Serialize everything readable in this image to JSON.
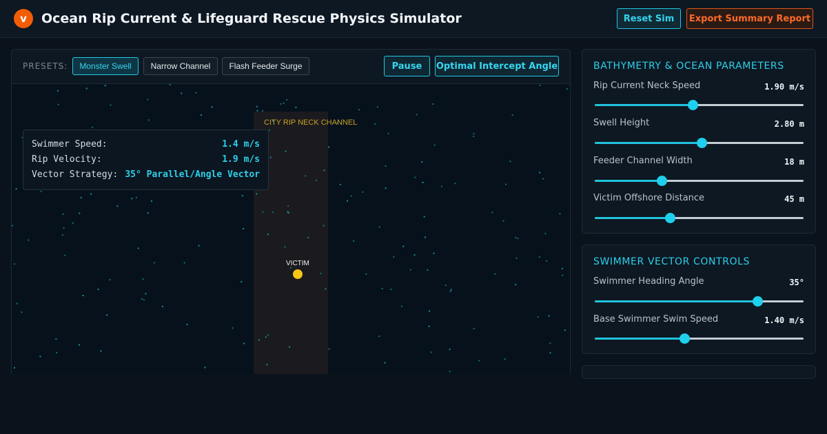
{
  "header": {
    "logo_letter": "v",
    "title": "Ocean Rip Current & Lifeguard Rescue Physics Simulator",
    "reset_label": "Reset Sim",
    "export_label": "Export Summary Report"
  },
  "toolbar": {
    "presets_label": "PRESETS:",
    "presets": [
      "Monster Swell",
      "Narrow Channel",
      "Flash Feeder Surge"
    ],
    "active_preset": "Monster Swell",
    "pause_label": "Pause",
    "intercept_label": "Optimal Intercept Angle"
  },
  "stats": [
    {
      "label": "Swimmer Speed:",
      "value": "1.4 m/s"
    },
    {
      "label": "Rip Velocity:",
      "value": "1.9 m/s"
    },
    {
      "label": "Vector Strategy:",
      "value": "35° Parallel/Angle Vector"
    }
  ],
  "canvas": {
    "channel_label": "CITY RIP NECK CHANNEL",
    "victim_label": "VICTIM"
  },
  "bathymetry": {
    "title": "BATHYMETRY & OCEAN PARAMETERS",
    "params": [
      {
        "label": "Rip Current Neck Speed",
        "value": "1.90 m/s",
        "level": 0.47
      },
      {
        "label": "Swell Height",
        "value": "2.80 m",
        "level": 0.51
      },
      {
        "label": "Feeder Channel Width",
        "value": "18 m",
        "level": 0.32
      },
      {
        "label": "Victim Offshore Distance",
        "value": "45 m",
        "level": 0.36
      }
    ]
  },
  "swimmer": {
    "title": "SWIMMER VECTOR CONTROLS",
    "params": [
      {
        "label": "Swimmer Heading Angle",
        "value": "35°",
        "level": 0.78
      },
      {
        "label": "Base Swimmer Swim Speed",
        "value": "1.40 m/s",
        "level": 0.43
      }
    ]
  },
  "colors": {
    "accent": "#22c9e5",
    "brand": "#f25c05",
    "channel_label": "#c9a227",
    "victim": "#f5c518"
  }
}
